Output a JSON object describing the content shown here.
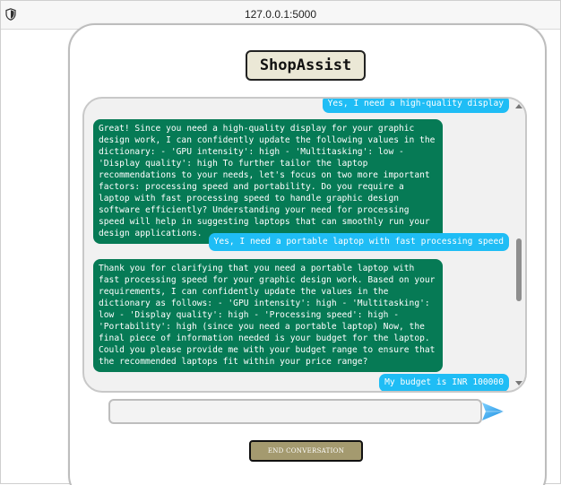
{
  "browser": {
    "url": "127.0.0.1:5000"
  },
  "app": {
    "title": "ShopAssist"
  },
  "conversation": [
    {
      "role": "user",
      "text": "Yes, I need a high-quality display"
    },
    {
      "role": "assistant",
      "text": "Great! Since you need a high-quality display for your graphic design work, I can confidently update the following values in the dictionary: - 'GPU intensity': high - 'Multitasking': low - 'Display quality': high To further tailor the laptop recommendations to your needs, let's focus on two more important factors: processing speed and portability. Do you require a laptop with fast processing speed to handle graphic design software efficiently? Understanding your need for processing speed will help in suggesting laptops that can smoothly run your design applications."
    },
    {
      "role": "user",
      "text": "Yes, I need a portable laptop with fast processing speed"
    },
    {
      "role": "assistant",
      "text": "Thank you for clarifying that you need a portable laptop with fast processing speed for your graphic design work. Based on your requirements, I can confidently update the values in the dictionary as follows: - 'GPU intensity': high - 'Multitasking': low - 'Display quality': high - 'Processing speed': high - 'Portability': high (since you need a portable laptop) Now, the final piece of information needed is your budget for the laptop. Could you please provide me with your budget range to ensure that the recommended laptops fit within your price range?"
    },
    {
      "role": "user",
      "text": "My budget is INR 100000"
    }
  ],
  "input": {
    "value": "",
    "placeholder": ""
  },
  "buttons": {
    "send_icon": "send-arrow-icon",
    "end_label": "END CONVERSATION"
  },
  "colors": {
    "user_bubble": "#1fbdf5",
    "assistant_bubble": "#067a55",
    "title_bg": "#ebe8d6",
    "end_button_bg": "#a49a6f",
    "send_icon": "#3aa8ef"
  }
}
